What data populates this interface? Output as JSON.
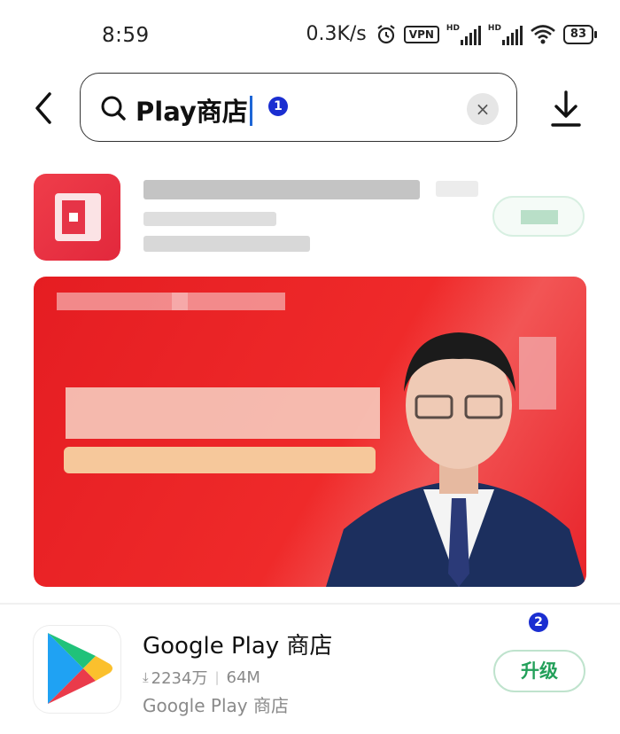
{
  "status_bar": {
    "time": "8:59",
    "network_speed": "0.3K/s",
    "vpn_label": "VPN",
    "signal1_label": "HD",
    "signal2_label": "HD",
    "battery": "83"
  },
  "search": {
    "query": "Play商店",
    "clear_icon": "×"
  },
  "annotations": {
    "badge1": "1",
    "badge2": "2"
  },
  "results": [
    {
      "app_name": "Google Play 商店",
      "downloads": "2234万",
      "size": "64M",
      "developer": "Google Play 商店",
      "action_label": "升级"
    }
  ],
  "colors": {
    "accent_green": "#23a05a",
    "badge_blue": "#1a2ed1",
    "banner_red": "#e51d22"
  }
}
